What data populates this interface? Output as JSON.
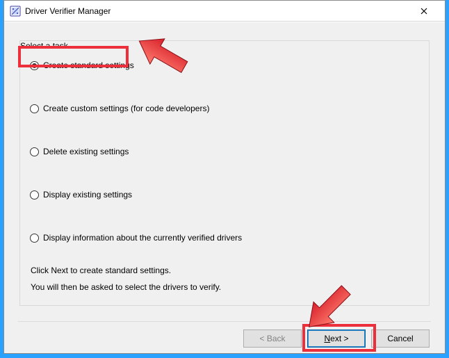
{
  "window": {
    "title": "Driver Verifier Manager"
  },
  "task": {
    "legend": "Select a task",
    "options": {
      "o0": "Create standard settings",
      "o1": "Create custom settings (for code developers)",
      "o2": "Delete existing settings",
      "o3": "Display existing settings",
      "o4": "Display information about the currently verified drivers"
    },
    "selected_index": 0,
    "help1": "Click Next to create standard settings.",
    "help2": "You will then be asked to select the drivers to verify."
  },
  "buttons": {
    "back": "< Back",
    "next": "Next >",
    "cancel": "Cancel"
  },
  "annotations": {
    "highlight_option_index": 0,
    "highlight_button": "next"
  }
}
